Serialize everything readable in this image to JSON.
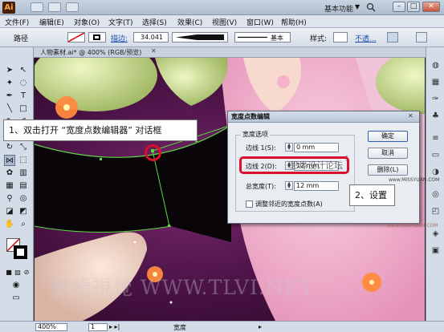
{
  "app": {
    "logo": "Ai",
    "workspace": "基本功能",
    "workspace_arrow": "▼"
  },
  "window_controls": {
    "minimize": "–",
    "maximize": "□",
    "close": "✕"
  },
  "menubar": [
    "文件(F)",
    "编辑(E)",
    "对象(O)",
    "文字(T)",
    "选择(S)",
    "效果(C)",
    "视图(V)",
    "窗口(W)",
    "帮助(H)"
  ],
  "controlbar": {
    "path_label": "路径",
    "stroke_label": "描边:",
    "stroke_value": "34.041",
    "profile_label": "基本",
    "style_label": "样式:",
    "opacity_label": "不透..."
  },
  "document": {
    "tab_label": "人物素材.ai* @ 400% (RGB/预览)",
    "close": "✕"
  },
  "status": {
    "zoom": "400%",
    "page": "1",
    "mode": "宽度"
  },
  "dialog": {
    "title": "宽度点数编辑",
    "close": "✕",
    "group_title": "宽度选项",
    "side1_label": "边线 1(S):",
    "side1_value": "0 mm",
    "side2_label": "边线 2(D):",
    "side2_value": "12 mm",
    "total_label": "总宽度(T):",
    "total_value": "12 mm",
    "adjust_label": "调整邻近的宽度点数(A)",
    "ok": "确定",
    "cancel": "取消",
    "delete": "删除(L)",
    "link_icon": "§"
  },
  "annotations": {
    "step1": "1、双击打开 “宽度点数编辑器” 对话框",
    "step2": "2、设置",
    "overlay_text": "思缘设计论坛",
    "url_small": "www.MISSYUAN.COM",
    "url_small_2": "www.MISSYUAN.COM",
    "bottom_watermark": "騰龍視覺 WWW.TLVI.NET"
  },
  "colors": {
    "canvas_bg": "#3a0e35",
    "highlight": "#d8102c",
    "dialog_bg": "#e9edf2"
  }
}
